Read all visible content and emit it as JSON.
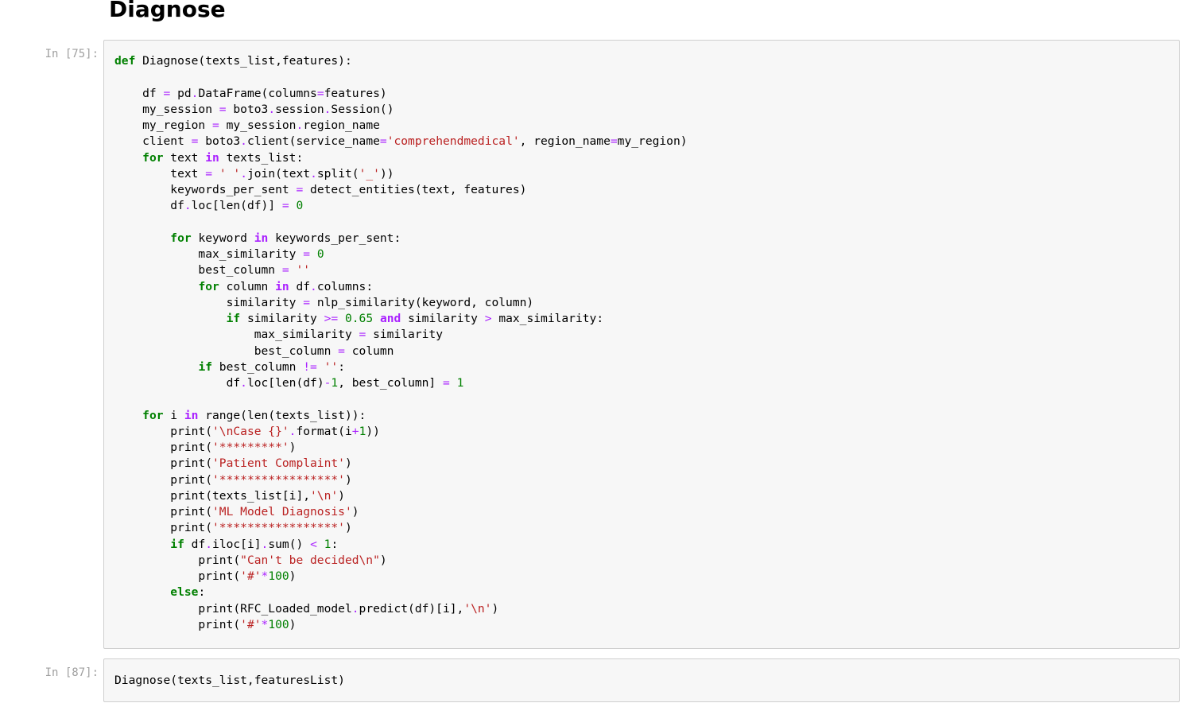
{
  "heading": "Diagnose",
  "cells": [
    {
      "prompt": "In [75]:",
      "lines": [
        [
          {
            "t": "def",
            "c": "kw"
          },
          {
            "t": " Diagnose(texts_list,features):"
          }
        ],
        [],
        [
          {
            "t": "    df "
          },
          {
            "t": "=",
            "c": "op"
          },
          {
            "t": " pd"
          },
          {
            "t": ".",
            "c": "op"
          },
          {
            "t": "DataFrame(columns"
          },
          {
            "t": "=",
            "c": "op"
          },
          {
            "t": "features)"
          }
        ],
        [
          {
            "t": "    my_session "
          },
          {
            "t": "=",
            "c": "op"
          },
          {
            "t": " boto3"
          },
          {
            "t": ".",
            "c": "op"
          },
          {
            "t": "session"
          },
          {
            "t": ".",
            "c": "op"
          },
          {
            "t": "Session()"
          }
        ],
        [
          {
            "t": "    my_region "
          },
          {
            "t": "=",
            "c": "op"
          },
          {
            "t": " my_session"
          },
          {
            "t": ".",
            "c": "op"
          },
          {
            "t": "region_name"
          }
        ],
        [
          {
            "t": "    client "
          },
          {
            "t": "=",
            "c": "op"
          },
          {
            "t": " boto3"
          },
          {
            "t": ".",
            "c": "op"
          },
          {
            "t": "client(service_name"
          },
          {
            "t": "=",
            "c": "op"
          },
          {
            "t": "'comprehendmedical'",
            "c": "st"
          },
          {
            "t": ", region_name"
          },
          {
            "t": "=",
            "c": "op"
          },
          {
            "t": "my_region)"
          }
        ],
        [
          {
            "t": "    "
          },
          {
            "t": "for",
            "c": "kw"
          },
          {
            "t": " text "
          },
          {
            "t": "in",
            "c": "ow"
          },
          {
            "t": " texts_list:"
          }
        ],
        [
          {
            "t": "        text "
          },
          {
            "t": "=",
            "c": "op"
          },
          {
            "t": " "
          },
          {
            "t": "' '",
            "c": "st"
          },
          {
            "t": ".",
            "c": "op"
          },
          {
            "t": "join(text"
          },
          {
            "t": ".",
            "c": "op"
          },
          {
            "t": "split("
          },
          {
            "t": "'_'",
            "c": "st"
          },
          {
            "t": "))"
          }
        ],
        [
          {
            "t": "        keywords_per_sent "
          },
          {
            "t": "=",
            "c": "op"
          },
          {
            "t": " detect_entities(text, features)"
          }
        ],
        [
          {
            "t": "        df"
          },
          {
            "t": ".",
            "c": "op"
          },
          {
            "t": "loc[len(df)] "
          },
          {
            "t": "=",
            "c": "op"
          },
          {
            "t": " "
          },
          {
            "t": "0",
            "c": "nu"
          }
        ],
        [],
        [
          {
            "t": "        "
          },
          {
            "t": "for",
            "c": "kw"
          },
          {
            "t": " keyword "
          },
          {
            "t": "in",
            "c": "ow"
          },
          {
            "t": " keywords_per_sent:"
          }
        ],
        [
          {
            "t": "            max_similarity "
          },
          {
            "t": "=",
            "c": "op"
          },
          {
            "t": " "
          },
          {
            "t": "0",
            "c": "nu"
          }
        ],
        [
          {
            "t": "            best_column "
          },
          {
            "t": "=",
            "c": "op"
          },
          {
            "t": " "
          },
          {
            "t": "''",
            "c": "st"
          }
        ],
        [
          {
            "t": "            "
          },
          {
            "t": "for",
            "c": "kw"
          },
          {
            "t": " column "
          },
          {
            "t": "in",
            "c": "ow"
          },
          {
            "t": " df"
          },
          {
            "t": ".",
            "c": "op"
          },
          {
            "t": "columns:"
          }
        ],
        [
          {
            "t": "                similarity "
          },
          {
            "t": "=",
            "c": "op"
          },
          {
            "t": " nlp_similarity(keyword, column)"
          }
        ],
        [
          {
            "t": "                "
          },
          {
            "t": "if",
            "c": "kw"
          },
          {
            "t": " similarity "
          },
          {
            "t": ">=",
            "c": "op"
          },
          {
            "t": " "
          },
          {
            "t": "0.65",
            "c": "nu"
          },
          {
            "t": " "
          },
          {
            "t": "and",
            "c": "ow"
          },
          {
            "t": " similarity "
          },
          {
            "t": ">",
            "c": "op"
          },
          {
            "t": " max_similarity:"
          }
        ],
        [
          {
            "t": "                    max_similarity "
          },
          {
            "t": "=",
            "c": "op"
          },
          {
            "t": " similarity"
          }
        ],
        [
          {
            "t": "                    best_column "
          },
          {
            "t": "=",
            "c": "op"
          },
          {
            "t": " column"
          }
        ],
        [
          {
            "t": "            "
          },
          {
            "t": "if",
            "c": "kw"
          },
          {
            "t": " best_column "
          },
          {
            "t": "!=",
            "c": "op"
          },
          {
            "t": " "
          },
          {
            "t": "''",
            "c": "st"
          },
          {
            "t": ":"
          }
        ],
        [
          {
            "t": "                df"
          },
          {
            "t": ".",
            "c": "op"
          },
          {
            "t": "loc[len(df)"
          },
          {
            "t": "-",
            "c": "op"
          },
          {
            "t": "1",
            "c": "nu"
          },
          {
            "t": ", best_column] "
          },
          {
            "t": "=",
            "c": "op"
          },
          {
            "t": " "
          },
          {
            "t": "1",
            "c": "nu"
          }
        ],
        [],
        [
          {
            "t": "    "
          },
          {
            "t": "for",
            "c": "kw"
          },
          {
            "t": " i "
          },
          {
            "t": "in",
            "c": "ow"
          },
          {
            "t": " range(len(texts_list)):"
          }
        ],
        [
          {
            "t": "        print("
          },
          {
            "t": "'\\nCase {}'",
            "c": "st"
          },
          {
            "t": ".",
            "c": "op"
          },
          {
            "t": "format(i"
          },
          {
            "t": "+",
            "c": "op"
          },
          {
            "t": "1",
            "c": "nu"
          },
          {
            "t": "))"
          }
        ],
        [
          {
            "t": "        print("
          },
          {
            "t": "'*********'",
            "c": "st"
          },
          {
            "t": ")"
          }
        ],
        [
          {
            "t": "        print("
          },
          {
            "t": "'Patient Complaint'",
            "c": "st"
          },
          {
            "t": ")"
          }
        ],
        [
          {
            "t": "        print("
          },
          {
            "t": "'*****************'",
            "c": "st"
          },
          {
            "t": ")"
          }
        ],
        [
          {
            "t": "        print(texts_list[i],"
          },
          {
            "t": "'\\n'",
            "c": "st"
          },
          {
            "t": ")"
          }
        ],
        [
          {
            "t": "        print("
          },
          {
            "t": "'ML Model Diagnosis'",
            "c": "st"
          },
          {
            "t": ")"
          }
        ],
        [
          {
            "t": "        print("
          },
          {
            "t": "'*****************'",
            "c": "st"
          },
          {
            "t": ")"
          }
        ],
        [
          {
            "t": "        "
          },
          {
            "t": "if",
            "c": "kw"
          },
          {
            "t": " df"
          },
          {
            "t": ".",
            "c": "op"
          },
          {
            "t": "iloc[i]"
          },
          {
            "t": ".",
            "c": "op"
          },
          {
            "t": "sum() "
          },
          {
            "t": "<",
            "c": "op"
          },
          {
            "t": " "
          },
          {
            "t": "1",
            "c": "nu"
          },
          {
            "t": ":"
          }
        ],
        [
          {
            "t": "            print("
          },
          {
            "t": "\"Can't be decided\\n\"",
            "c": "st"
          },
          {
            "t": ")"
          }
        ],
        [
          {
            "t": "            print("
          },
          {
            "t": "'#'",
            "c": "st"
          },
          {
            "t": "*",
            "c": "op"
          },
          {
            "t": "100",
            "c": "nu"
          },
          {
            "t": ")"
          }
        ],
        [
          {
            "t": "        "
          },
          {
            "t": "else",
            "c": "kw"
          },
          {
            "t": ":"
          }
        ],
        [
          {
            "t": "            print(RFC_Loaded_model"
          },
          {
            "t": ".",
            "c": "op"
          },
          {
            "t": "predict(df)[i],"
          },
          {
            "t": "'\\n'",
            "c": "st"
          },
          {
            "t": ")"
          }
        ],
        [
          {
            "t": "            print("
          },
          {
            "t": "'#'",
            "c": "st"
          },
          {
            "t": "*",
            "c": "op"
          },
          {
            "t": "100",
            "c": "nu"
          },
          {
            "t": ")"
          }
        ]
      ]
    },
    {
      "prompt": "In [87]:",
      "lines": [
        [
          {
            "t": "Diagnose(texts_list,featuresList)"
          }
        ]
      ]
    }
  ]
}
